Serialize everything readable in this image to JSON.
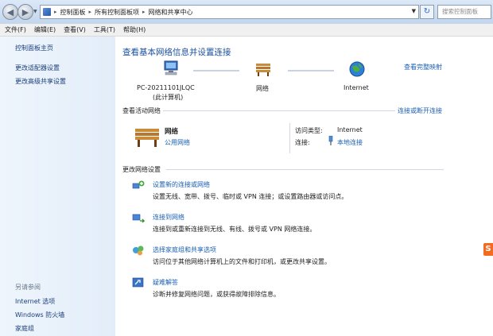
{
  "address_bar": {
    "breadcrumbs": [
      "控制面板",
      "所有控制面板项",
      "网络和共享中心"
    ],
    "search_placeholder": "搜索控制面板"
  },
  "menu": [
    "文件(F)",
    "编辑(E)",
    "查看(V)",
    "工具(T)",
    "帮助(H)"
  ],
  "left_pane": {
    "links": [
      "控制面板主页",
      "更改适配器设置",
      "更改高级共享设置"
    ],
    "see_also_header": "另请参阅",
    "see_also_links": [
      "Internet 选项",
      "Windows 防火墙",
      "家庭组"
    ]
  },
  "main": {
    "title": "查看基本网络信息并设置连接",
    "full_map_link": "查看完整映射",
    "map": {
      "computer_name": "PC-20211101JLQC",
      "computer_sub": "(此计算机)",
      "network_label": "网络",
      "internet_label": "Internet"
    },
    "active_networks": {
      "header": "查看活动网络",
      "connect_link": "连接或断开连接",
      "network_name": "网络",
      "network_type": "公用网络",
      "access_type_label": "访问类型:",
      "access_type_value": "Internet",
      "connections_label": "连接:",
      "connection_value": "本地连接"
    },
    "change_settings": {
      "header": "更改网络设置",
      "tasks": [
        {
          "title": "设置新的连接或网络",
          "desc": "设置无线、宽带、拨号、临时或 VPN 连接；或设置路由器或访问点。",
          "icon": "new-connection-icon"
        },
        {
          "title": "连接到网络",
          "desc": "连接到或重新连接到无线、有线、拨号或 VPN 网络连接。",
          "icon": "connect-network-icon"
        },
        {
          "title": "选择家庭组和共享选项",
          "desc": "访问位于其他网络计算机上的文件和打印机，或更改共享设置。",
          "icon": "homegroup-icon"
        },
        {
          "title": "疑难解答",
          "desc": "诊断并修复网络问题，或获得故障排除信息。",
          "icon": "troubleshoot-icon"
        }
      ]
    }
  },
  "edge_badge": "S"
}
